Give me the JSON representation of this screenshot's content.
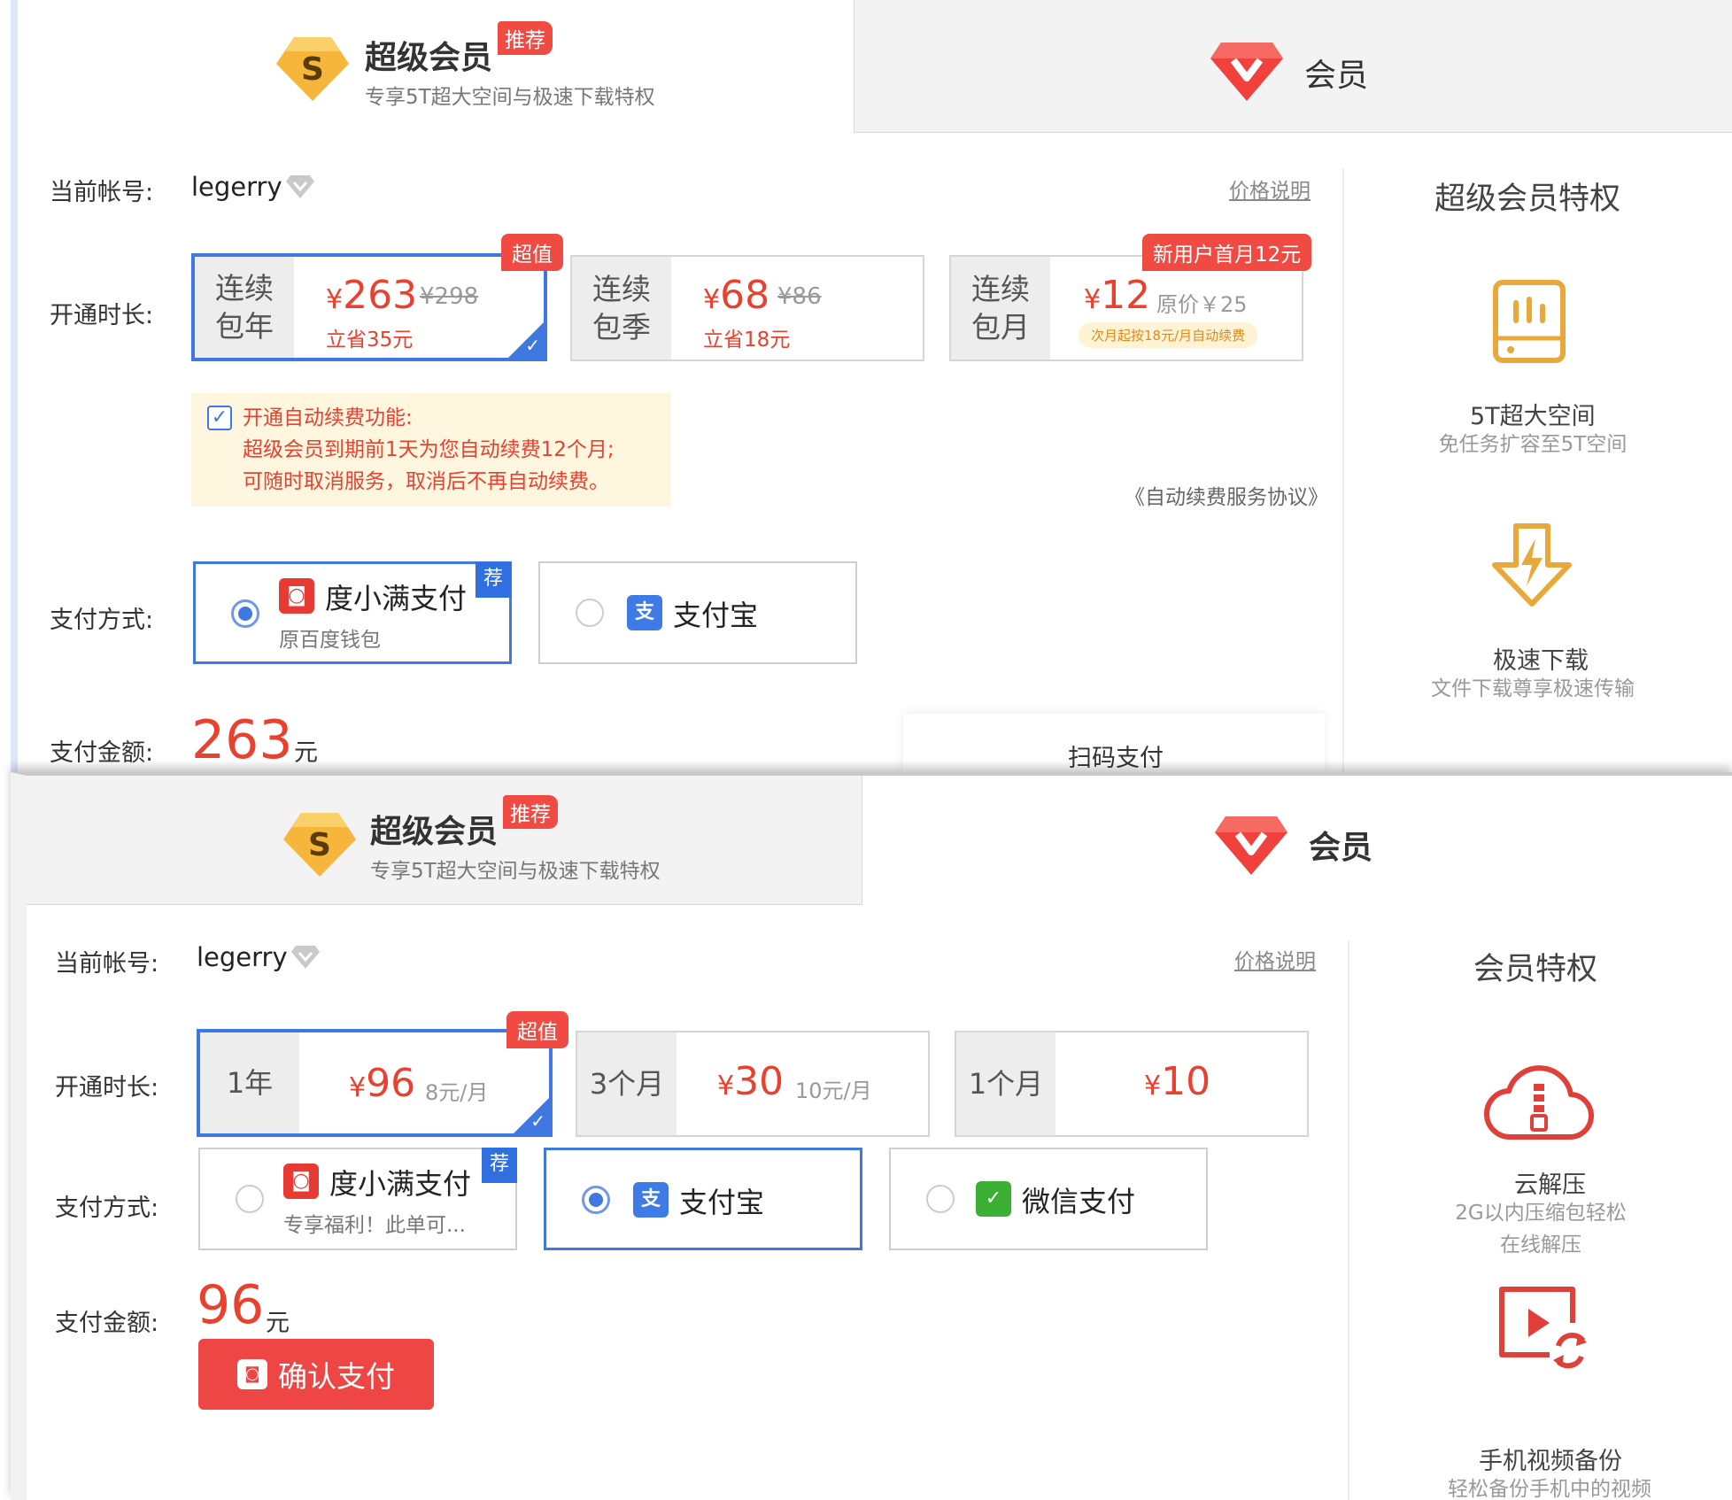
{
  "top": {
    "tab_super": {
      "title": "超级会员",
      "badge": "推荐",
      "subtitle": "专享5T超大空间与极速下载特权"
    },
    "tab_member": {
      "title": "会员"
    },
    "account_label": "当前帐号:",
    "username": "legerry",
    "price_explain": "价格说明",
    "duration_label": "开通时长:",
    "plans": [
      {
        "line1": "连续",
        "line2": "包年",
        "price": "263",
        "original": "¥298",
        "save": "立省35元",
        "badge": "超值",
        "selected": true
      },
      {
        "line1": "连续",
        "line2": "包季",
        "price": "68",
        "original": "¥86",
        "save": "立省18元"
      },
      {
        "line1": "连续",
        "line2": "包月",
        "price": "12",
        "original": "原价￥25",
        "note": "次月起按18元/月自动续费",
        "badge": "新用户首月12元"
      }
    ],
    "auto_renew": {
      "title": "开通自动续费功能:",
      "line1": "超级会员到期前1天为您自动续费12个月;",
      "line2": "可随时取消服务，取消后不再自动续费。"
    },
    "agreement": "《自动续费服务协议》",
    "payment_label": "支付方式:",
    "payments": [
      {
        "name": "度小满支付",
        "sub": "原百度钱包",
        "badge": "荐",
        "selected": true
      },
      {
        "name": "支付宝"
      }
    ],
    "amount_label": "支付金额:",
    "amount": "263",
    "amount_unit": "元",
    "scan_pay": "扫码支付",
    "privileges_title": "超级会员特权",
    "features": [
      {
        "name": "5T超大空间",
        "desc": "免任务扩容至5T空间"
      },
      {
        "name": "极速下载",
        "desc": "文件下载尊享极速传输"
      }
    ]
  },
  "bottom": {
    "tab_super": {
      "title": "超级会员",
      "badge": "推荐",
      "subtitle": "专享5T超大空间与极速下载特权"
    },
    "tab_member": {
      "title": "会员"
    },
    "account_label": "当前帐号:",
    "username": "legerry",
    "price_explain": "价格说明",
    "duration_label": "开通时长:",
    "plans": [
      {
        "label": "1年",
        "price": "96",
        "per": "8元/月",
        "badge": "超值",
        "selected": true
      },
      {
        "label": "3个月",
        "price": "30",
        "per": "10元/月"
      },
      {
        "label": "1个月",
        "price": "10"
      }
    ],
    "payment_label": "支付方式:",
    "payments": [
      {
        "name": "度小满支付",
        "sub": "专享福利！此单可...",
        "badge": "荐"
      },
      {
        "name": "支付宝",
        "selected": true
      },
      {
        "name": "微信支付"
      }
    ],
    "amount_label": "支付金额:",
    "amount": "96",
    "amount_unit": "元",
    "confirm": "确认支付",
    "privileges_title": "会员特权",
    "features": [
      {
        "name": "云解压",
        "desc1": "2G以内压缩包轻松",
        "desc2": "在线解压"
      },
      {
        "name": "手机视频备份",
        "desc": "轻松备份手机中的视频"
      }
    ]
  },
  "icons": {
    "super_badge": "super-member-s-icon",
    "member_badge": "member-v-diamond-icon",
    "vip_diamond": "grey-diamond-icon",
    "duxiaoman": "duxiaoman-wallet-icon",
    "alipay": "alipay-icon",
    "wechat": "wechat-pay-icon",
    "storage": "storage-disk-icon",
    "download": "fast-download-icon",
    "cloud_unzip": "cloud-unzip-icon",
    "video_backup": "video-backup-icon"
  },
  "colors": {
    "accent_red": "#e8412f",
    "select_blue": "#3f78e0",
    "gold": "#e8a93a",
    "notice_bg": "#fff6e0"
  }
}
